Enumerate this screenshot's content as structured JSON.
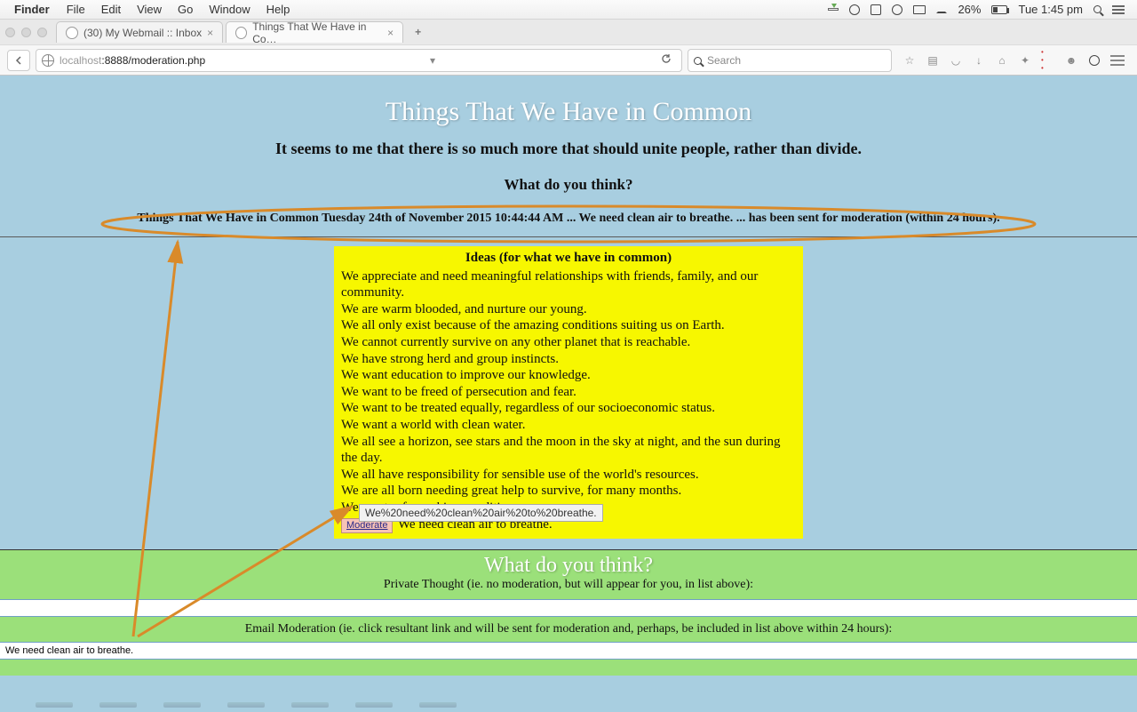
{
  "menubar": {
    "app": "Finder",
    "items": [
      "File",
      "Edit",
      "View",
      "Go",
      "Window",
      "Help"
    ],
    "battery": "26%",
    "clock": "Tue 1:45 pm"
  },
  "tabs": {
    "inactive": "(30) My Webmail :: Inbox",
    "active": "Things That We Have in Co…"
  },
  "url": {
    "host": "localhost",
    "portpath": ":8888/moderation.php"
  },
  "search_placeholder": "Search",
  "page": {
    "title": "Things That We Have in Common",
    "subtitle1": "It seems to me that there is so much more that should unite people, rather than divide.",
    "subtitle2": "What do you think?",
    "notice": "Things That We Have in Common Tuesday 24th of November 2015 10:44:44 AM ... We need clean air to breathe. ... has been sent for moderation (within 24 hours).",
    "ideas_heading": "Ideas (for what we have in common)",
    "ideas": [
      "We appreciate and need meaningful relationships with friends, family, and our community.",
      "We are warm blooded, and nurture our young.",
      "We all only exist because of the amazing conditions suiting us on Earth.",
      "We cannot currently survive on any other planet that is reachable.",
      "We have strong herd and group instincts.",
      "We want education to improve our knowledge.",
      "We want to be freed of persecution and fear.",
      "We want to be treated equally, regardless of our socioeconomic status.",
      "We want a world with clean water.",
      "We all see a horizon, see stars and the moon in the sky at night, and the sun during the day.",
      "We all have responsibility for sensible use of the world's resources.",
      "We are all born needing great help to survive, for many months.",
      "We want safe working conditions."
    ],
    "moderate_label": "Moderate",
    "pending_idea": "We need clean air to breathe.",
    "tooltip": "We%20need%20clean%20air%20to%20breathe.",
    "form_heading": "What do you think?",
    "private_label": "Private Thought (ie. no moderation, but will appear for you, in list above):",
    "email_label": "Email Moderation (ie. click resultant link and will be sent for moderation and, perhaps, be included in list above within 24 hours):",
    "email_value": "We need clean air to breathe."
  }
}
